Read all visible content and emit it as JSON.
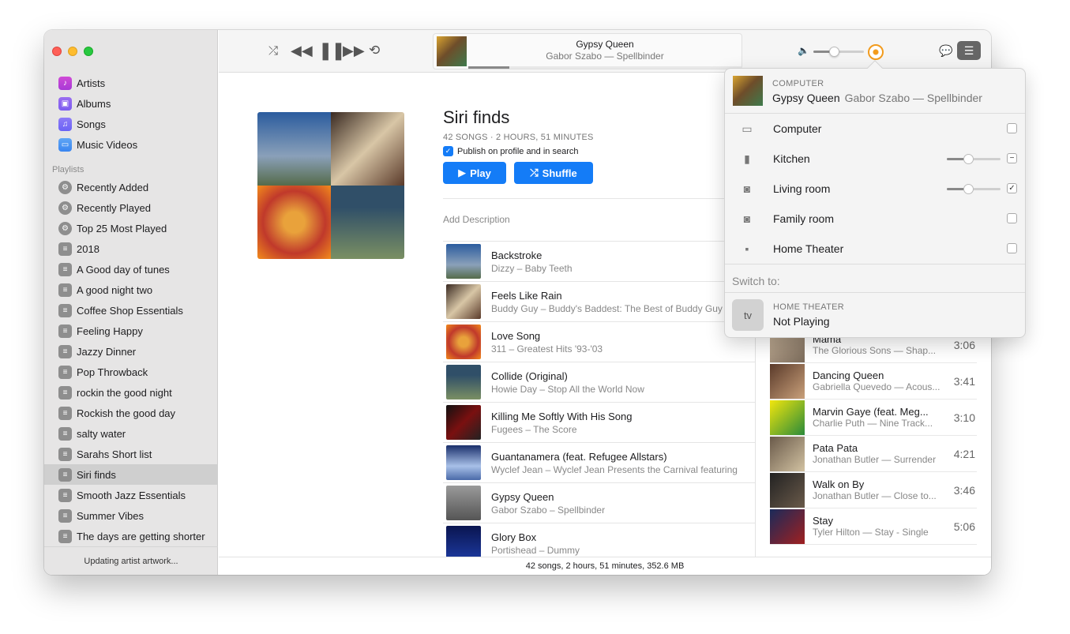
{
  "sidebar": {
    "library": [
      {
        "label": "Artists",
        "icon": "microphone-icon"
      },
      {
        "label": "Albums",
        "icon": "album-icon"
      },
      {
        "label": "Songs",
        "icon": "music-note-icon"
      },
      {
        "label": "Music Videos",
        "icon": "tv-icon"
      }
    ],
    "playlists_header": "Playlists",
    "playlists": [
      "Recently Added",
      "Recently Played",
      "Top 25 Most Played",
      "2018",
      "A Good day of tunes",
      "A good night two",
      "Coffee Shop Essentials",
      "Feeling Happy",
      "Jazzy Dinner",
      "Pop Throwback",
      "rockin the good night",
      "Rockish the good day",
      "salty water",
      "Sarahs Short list",
      "Siri finds",
      "Smooth Jazz Essentials",
      "Summer Vibes",
      "The days are getting shorter"
    ],
    "selected": "Siri finds",
    "footer": "Updating artist artwork..."
  },
  "now_playing": {
    "title": "Gypsy Queen",
    "subtitle": "Gabor Szabo — Spellbinder",
    "progress": 0.15
  },
  "volume": 0.4,
  "playlist": {
    "title": "Siri finds",
    "meta": "42 SONGS · 2 HOURS, 51 MINUTES",
    "publish_label": "Publish on profile and in search",
    "publish_checked": true,
    "play_label": "Play",
    "shuffle_label": "Shuffle",
    "add_description": "Add Description",
    "songs": [
      {
        "title": "Backstroke",
        "sub": "Dizzy – Baby Teeth"
      },
      {
        "title": "Feels Like Rain",
        "sub": "Buddy Guy – Buddy's Baddest: The Best of Buddy Guy"
      },
      {
        "title": "Love Song",
        "sub": "311 – Greatest Hits '93-'03"
      },
      {
        "title": "Collide (Original)",
        "sub": "Howie Day – Stop All the World Now"
      },
      {
        "title": "Killing Me Softly With His Song",
        "sub": "Fugees – The Score"
      },
      {
        "title": "Guantanamera (feat. Refugee Allstars)",
        "sub": "Wyclef Jean – Wyclef Jean Presents the Carnival featuring"
      },
      {
        "title": "Gypsy Queen",
        "sub": "Gabor Szabo – Spellbinder"
      },
      {
        "title": "Glory Box",
        "sub": "Portishead – Dummy"
      }
    ]
  },
  "up_next": [
    {
      "title": "Mama",
      "sub": "The Glorious Sons — Shap...",
      "dur": "3:06"
    },
    {
      "title": "Dancing Queen",
      "sub": "Gabriella Quevedo — Acous...",
      "dur": "3:41"
    },
    {
      "title": "Marvin Gaye (feat. Meg...",
      "sub": "Charlie Puth — Nine Track...",
      "dur": "3:10"
    },
    {
      "title": "Pata Pata",
      "sub": "Jonathan Butler — Surrender",
      "dur": "4:21"
    },
    {
      "title": "Walk on By",
      "sub": "Jonathan Butler — Close to...",
      "dur": "3:46"
    },
    {
      "title": "Stay",
      "sub": "Tyler Hilton — Stay - Single",
      "dur": "5:06"
    }
  ],
  "status": "42 songs, 2 hours, 51 minutes, 352.6 MB",
  "airplay": {
    "now_label": "COMPUTER",
    "now_title": "Gypsy Queen",
    "now_sub": "Gabor Szabo — Spellbinder",
    "devices": [
      {
        "name": "Computer",
        "icon": "display-icon",
        "state": "unchecked"
      },
      {
        "name": "Kitchen",
        "icon": "homepod-icon",
        "state": "mixed",
        "volume": 0.4
      },
      {
        "name": "Living room",
        "icon": "speaker-icon",
        "state": "checked",
        "volume": 0.4
      },
      {
        "name": "Family room",
        "icon": "speaker-icon",
        "state": "unchecked"
      },
      {
        "name": "Home Theater",
        "icon": "appletv-icon",
        "state": "unchecked"
      }
    ],
    "switch_label": "Switch to:",
    "switch_device_label": "HOME THEATER",
    "switch_device_status": "Not Playing"
  },
  "colors": {
    "accent": "#147cf7",
    "airplay_active": "#f29b1d",
    "sidebar_bg": "#e6e5e5"
  }
}
